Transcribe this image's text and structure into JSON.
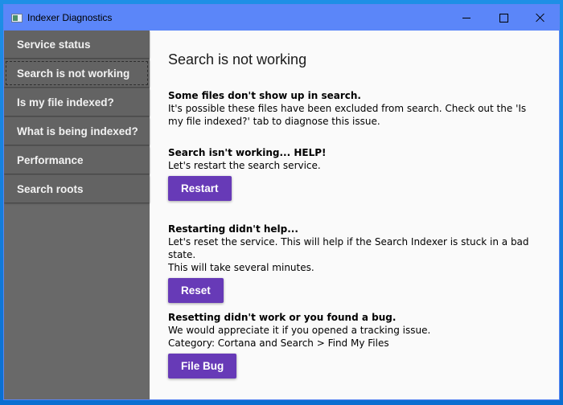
{
  "window": {
    "title": "Indexer Diagnostics",
    "controls": {
      "minimize": "minimize",
      "maximize": "maximize",
      "close": "close"
    }
  },
  "sidebar": {
    "items": [
      {
        "label": "Service status",
        "selected": false
      },
      {
        "label": "Search is not working",
        "selected": true
      },
      {
        "label": "Is my file indexed?",
        "selected": false
      },
      {
        "label": "What is being indexed?",
        "selected": false
      },
      {
        "label": "Performance",
        "selected": false
      },
      {
        "label": "Search roots",
        "selected": false
      }
    ]
  },
  "main": {
    "title": "Search is not working",
    "sections": [
      {
        "heading": "Some files don't show up in search.",
        "lines": [
          "It's possible these files have been excluded from search. Check out the 'Is my file indexed?' tab to diagnose this issue."
        ]
      },
      {
        "heading": "Search isn't working... HELP!",
        "lines": [
          "Let's restart the search service."
        ],
        "button": "Restart"
      },
      {
        "heading": "Restarting didn't help...",
        "lines": [
          "Let's reset the service. This will help if the Search Indexer is stuck in a bad state.",
          "This will take several minutes."
        ],
        "button": "Reset"
      },
      {
        "heading": "Resetting didn't work or you found a bug.",
        "lines": [
          "We would appreciate it if you opened a tracking issue.",
          "Category: Cortana and Search > Find My Files"
        ],
        "button": "File Bug"
      }
    ]
  },
  "colors": {
    "titlebar": "#5b86f9",
    "sidebar": "#696969",
    "nav_item": "#636363",
    "accent_button": "#673ab7"
  }
}
